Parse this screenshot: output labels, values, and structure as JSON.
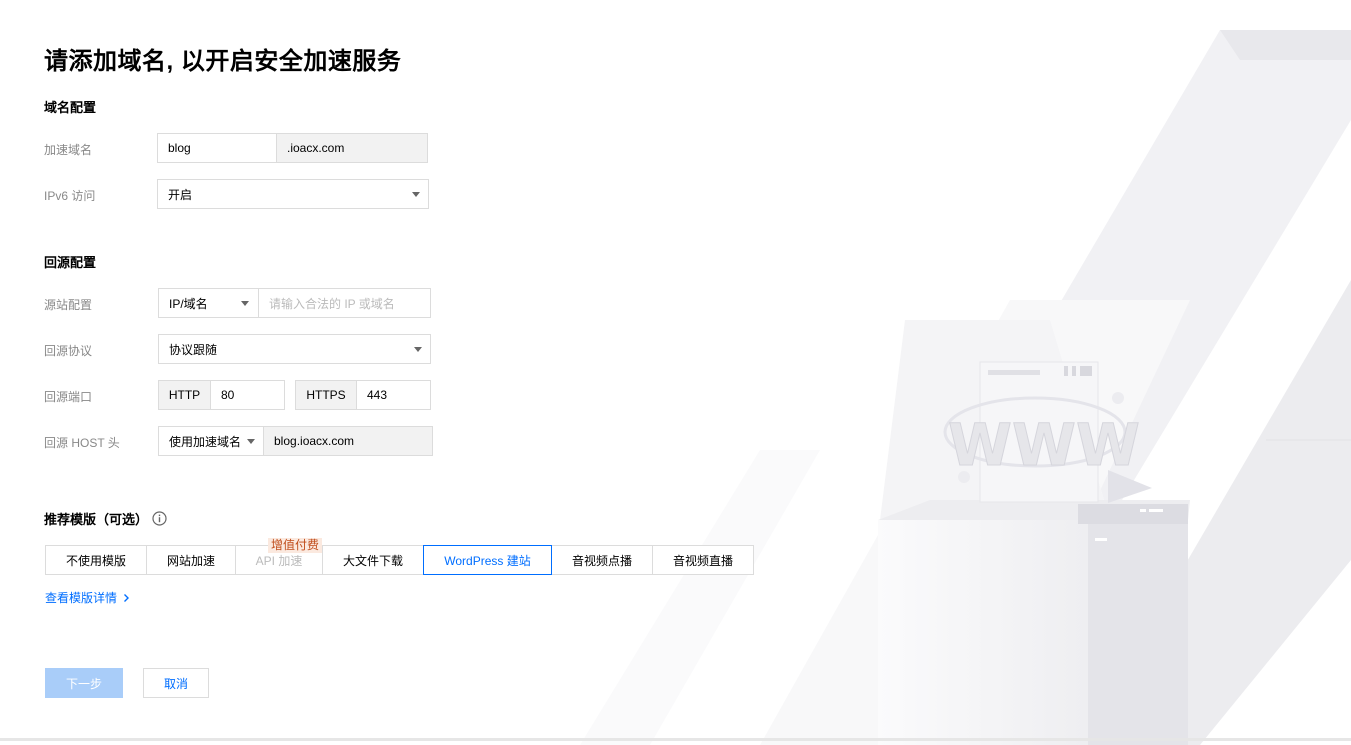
{
  "page": {
    "title": "请添加域名, 以开启安全加速服务"
  },
  "domain_config": {
    "title": "域名配置",
    "domain": {
      "label": "加速域名",
      "value": "blog",
      "suffix": ".ioacx.com"
    },
    "ipv6": {
      "label": "IPv6 访问",
      "value": "开启"
    }
  },
  "origin_config": {
    "title": "回源配置",
    "origin": {
      "label": "源站配置",
      "type": "IP/域名",
      "placeholder": "请输入合法的 IP 或域名"
    },
    "protocol": {
      "label": "回源协议",
      "value": "协议跟随"
    },
    "port": {
      "label": "回源端口",
      "http_label": "HTTP",
      "http_value": "80",
      "https_label": "HTTPS",
      "https_value": "443"
    },
    "host": {
      "label": "回源 HOST 头",
      "type": "使用加速域名",
      "value": "blog.ioacx.com"
    }
  },
  "templates": {
    "title": "推荐模版（可选）",
    "items": [
      "不使用模版",
      "网站加速",
      "API 加速",
      "大文件下载",
      "WordPress 建站",
      "音视频点播",
      "音视频直播"
    ],
    "selected": "WordPress 建站",
    "badge": "增值付费",
    "details_link": "查看模版详情"
  },
  "actions": {
    "next": "下一步",
    "cancel": "取消"
  },
  "colors": {
    "accent": "#006eff",
    "disabled_button": "#a9cdf9",
    "badge_text": "#c04c1a"
  },
  "illustration": {
    "text": "WWW"
  }
}
